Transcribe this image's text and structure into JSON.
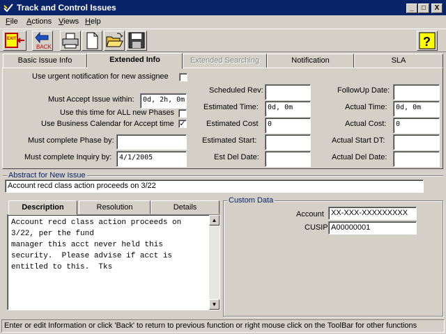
{
  "window": {
    "title": "Track and Control Issues",
    "min": "_",
    "max": "□",
    "close": "X"
  },
  "menu": [
    {
      "accel": "F",
      "rest": "ile"
    },
    {
      "accel": "A",
      "rest": "ctions"
    },
    {
      "accel": "V",
      "rest": "iews"
    },
    {
      "accel": "H",
      "rest": "elp"
    }
  ],
  "toolbar": {
    "exit_label": "EXIT",
    "back_label": "BACK",
    "help_label": "?"
  },
  "tabs": [
    "Basic Issue Info",
    "Extended Info",
    "Extended Searching",
    "Notification",
    "SLA"
  ],
  "extended": {
    "urgent_label": "Use urgent notification for new assignee",
    "must_accept_label": "Must Accept Issue within:",
    "must_accept_value": "0d, 2h, 0m",
    "use_time_label": "Use this time for ALL new Phases",
    "business_cal_label": "Use Business Calendar for Accept time",
    "business_cal_check": "✓",
    "phase_by_label": "Must complete Phase by:",
    "phase_by_value": "",
    "inquiry_by_label": "Must complete Inquiry by:",
    "inquiry_by_value": "4/1/2005",
    "scheduled_rev_label": "Scheduled Rev:",
    "scheduled_rev_value": "",
    "est_time_label": "Estimated Time:",
    "est_time_value": "0d, 0m",
    "est_cost_label": "Estimated Cost",
    "est_cost_value": "0",
    "est_start_label": "Estimated Start:",
    "est_start_value": "",
    "est_del_label": "Est Del Date:",
    "est_del_value": "",
    "followup_label": "FollowUp Date:",
    "followup_value": "",
    "actual_time_label": "Actual Time:",
    "actual_time_value": "0d, 0m",
    "actual_cost_label": "Actual Cost:",
    "actual_cost_value": "0",
    "actual_start_label": "Actual Start DT:",
    "actual_start_value": "",
    "actual_del_label": "Actual Del Date:",
    "actual_del_value": ""
  },
  "abstract": {
    "title": "Abstract for New Issue",
    "value": "Account recd class action proceeds on 3/22"
  },
  "subtabs": [
    "Description",
    "Resolution",
    "Details"
  ],
  "description": "Account recd class action proceeds on\n3/22, per the fund\nmanager this acct never held this\nsecurity.  Please advise if acct is\nentitled to this.  Tks",
  "custom": {
    "title": "Custom Data",
    "account_label": "Account",
    "account_value": "XX-XXX-XXXXXXXXX",
    "cusip_label": "CUSIP",
    "cusip_value": "A00000001"
  },
  "status": "Enter or edit Information or click 'Back' to return to previous function or right mouse click on the ToolBar for other functions",
  "colors": {
    "titlebar": "#0a246a",
    "face": "#d4d0c8",
    "group_title": "#0a246a"
  }
}
